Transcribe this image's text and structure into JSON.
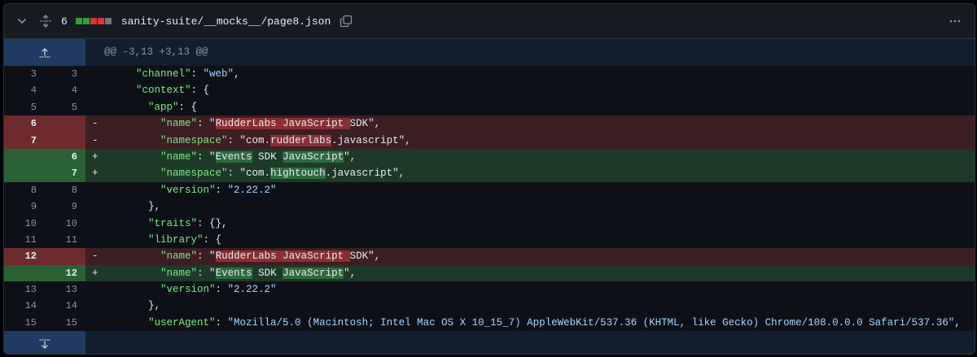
{
  "file": {
    "change_count": "6",
    "diffstat_colors": [
      "#2ea043",
      "#2ea043",
      "#da3633",
      "#da3633",
      "#6e7681"
    ],
    "path": "sanity-suite/__mocks__/page8.json"
  },
  "hunk_header": "@@ -3,13 +3,13 @@",
  "lines": [
    {
      "type": "ctx",
      "old": "3",
      "new": "3",
      "indent": "    ",
      "parts": [
        {
          "t": "\"channel\"",
          "c": "key"
        },
        {
          "t": ": "
        },
        {
          "t": "\"web\"",
          "c": "str"
        },
        {
          "t": ","
        }
      ]
    },
    {
      "type": "ctx",
      "old": "4",
      "new": "4",
      "indent": "    ",
      "parts": [
        {
          "t": "\"context\"",
          "c": "key"
        },
        {
          "t": ": {"
        }
      ]
    },
    {
      "type": "ctx",
      "old": "5",
      "new": "5",
      "indent": "      ",
      "parts": [
        {
          "t": "\"app\"",
          "c": "key"
        },
        {
          "t": ": {"
        }
      ]
    },
    {
      "type": "del",
      "old": "6",
      "new": "",
      "sign": "-",
      "indent": "        ",
      "parts": [
        {
          "t": "\"name\"",
          "c": "key"
        },
        {
          "t": ": "
        },
        {
          "t": "\""
        },
        {
          "t": "RudderLabs JavaScript ",
          "h": "del"
        },
        {
          "t": "SDK\""
        },
        {
          "t": ","
        }
      ]
    },
    {
      "type": "del",
      "old": "7",
      "new": "",
      "sign": "-",
      "indent": "        ",
      "parts": [
        {
          "t": "\"namespace\"",
          "c": "key"
        },
        {
          "t": ": "
        },
        {
          "t": "\"com."
        },
        {
          "t": "rudderlabs",
          "h": "del"
        },
        {
          "t": ".javascript\""
        },
        {
          "t": ","
        }
      ]
    },
    {
      "type": "add",
      "old": "",
      "new": "6",
      "sign": "+",
      "indent": "        ",
      "parts": [
        {
          "t": "\"name\"",
          "c": "key"
        },
        {
          "t": ": "
        },
        {
          "t": "\""
        },
        {
          "t": "Events",
          "h": "add"
        },
        {
          "t": " SDK "
        },
        {
          "t": "JavaScript",
          "h": "add"
        },
        {
          "t": "\""
        },
        {
          "t": ","
        }
      ]
    },
    {
      "type": "add",
      "old": "",
      "new": "7",
      "sign": "+",
      "indent": "        ",
      "parts": [
        {
          "t": "\"namespace\"",
          "c": "key"
        },
        {
          "t": ": "
        },
        {
          "t": "\"com."
        },
        {
          "t": "hightouch",
          "h": "add"
        },
        {
          "t": ".javascript\""
        },
        {
          "t": ","
        }
      ]
    },
    {
      "type": "ctx",
      "old": "8",
      "new": "8",
      "indent": "        ",
      "parts": [
        {
          "t": "\"version\"",
          "c": "key"
        },
        {
          "t": ": "
        },
        {
          "t": "\"2.22.2\"",
          "c": "str"
        }
      ]
    },
    {
      "type": "ctx",
      "old": "9",
      "new": "9",
      "indent": "      ",
      "parts": [
        {
          "t": "},"
        }
      ]
    },
    {
      "type": "ctx",
      "old": "10",
      "new": "10",
      "indent": "      ",
      "parts": [
        {
          "t": "\"traits\"",
          "c": "key"
        },
        {
          "t": ": {},"
        }
      ]
    },
    {
      "type": "ctx",
      "old": "11",
      "new": "11",
      "indent": "      ",
      "parts": [
        {
          "t": "\"library\"",
          "c": "key"
        },
        {
          "t": ": {"
        }
      ]
    },
    {
      "type": "del",
      "old": "12",
      "new": "",
      "sign": "-",
      "indent": "        ",
      "parts": [
        {
          "t": "\"name\"",
          "c": "key"
        },
        {
          "t": ": "
        },
        {
          "t": "\""
        },
        {
          "t": "RudderLabs JavaScript ",
          "h": "del"
        },
        {
          "t": "SDK\""
        },
        {
          "t": ","
        }
      ]
    },
    {
      "type": "add",
      "old": "",
      "new": "12",
      "sign": "+",
      "indent": "        ",
      "parts": [
        {
          "t": "\"name\"",
          "c": "key"
        },
        {
          "t": ": "
        },
        {
          "t": "\""
        },
        {
          "t": "Events",
          "h": "add"
        },
        {
          "t": " SDK "
        },
        {
          "t": "JavaScript",
          "h": "add"
        },
        {
          "t": "\""
        },
        {
          "t": ","
        }
      ]
    },
    {
      "type": "ctx",
      "old": "13",
      "new": "13",
      "indent": "        ",
      "parts": [
        {
          "t": "\"version\"",
          "c": "key"
        },
        {
          "t": ": "
        },
        {
          "t": "\"2.22.2\"",
          "c": "str"
        }
      ]
    },
    {
      "type": "ctx",
      "old": "14",
      "new": "14",
      "indent": "      ",
      "parts": [
        {
          "t": "},"
        }
      ]
    },
    {
      "type": "ctx",
      "old": "15",
      "new": "15",
      "indent": "      ",
      "parts": [
        {
          "t": "\"userAgent\"",
          "c": "key"
        },
        {
          "t": ": "
        },
        {
          "t": "\"Mozilla/5.0 (Macintosh; Intel Mac OS X 10_15_7) AppleWebKit/537.36 (KHTML, like Gecko) Chrome/108.0.0.0 Safari/537.36\"",
          "c": "str"
        },
        {
          "t": ","
        }
      ]
    }
  ]
}
